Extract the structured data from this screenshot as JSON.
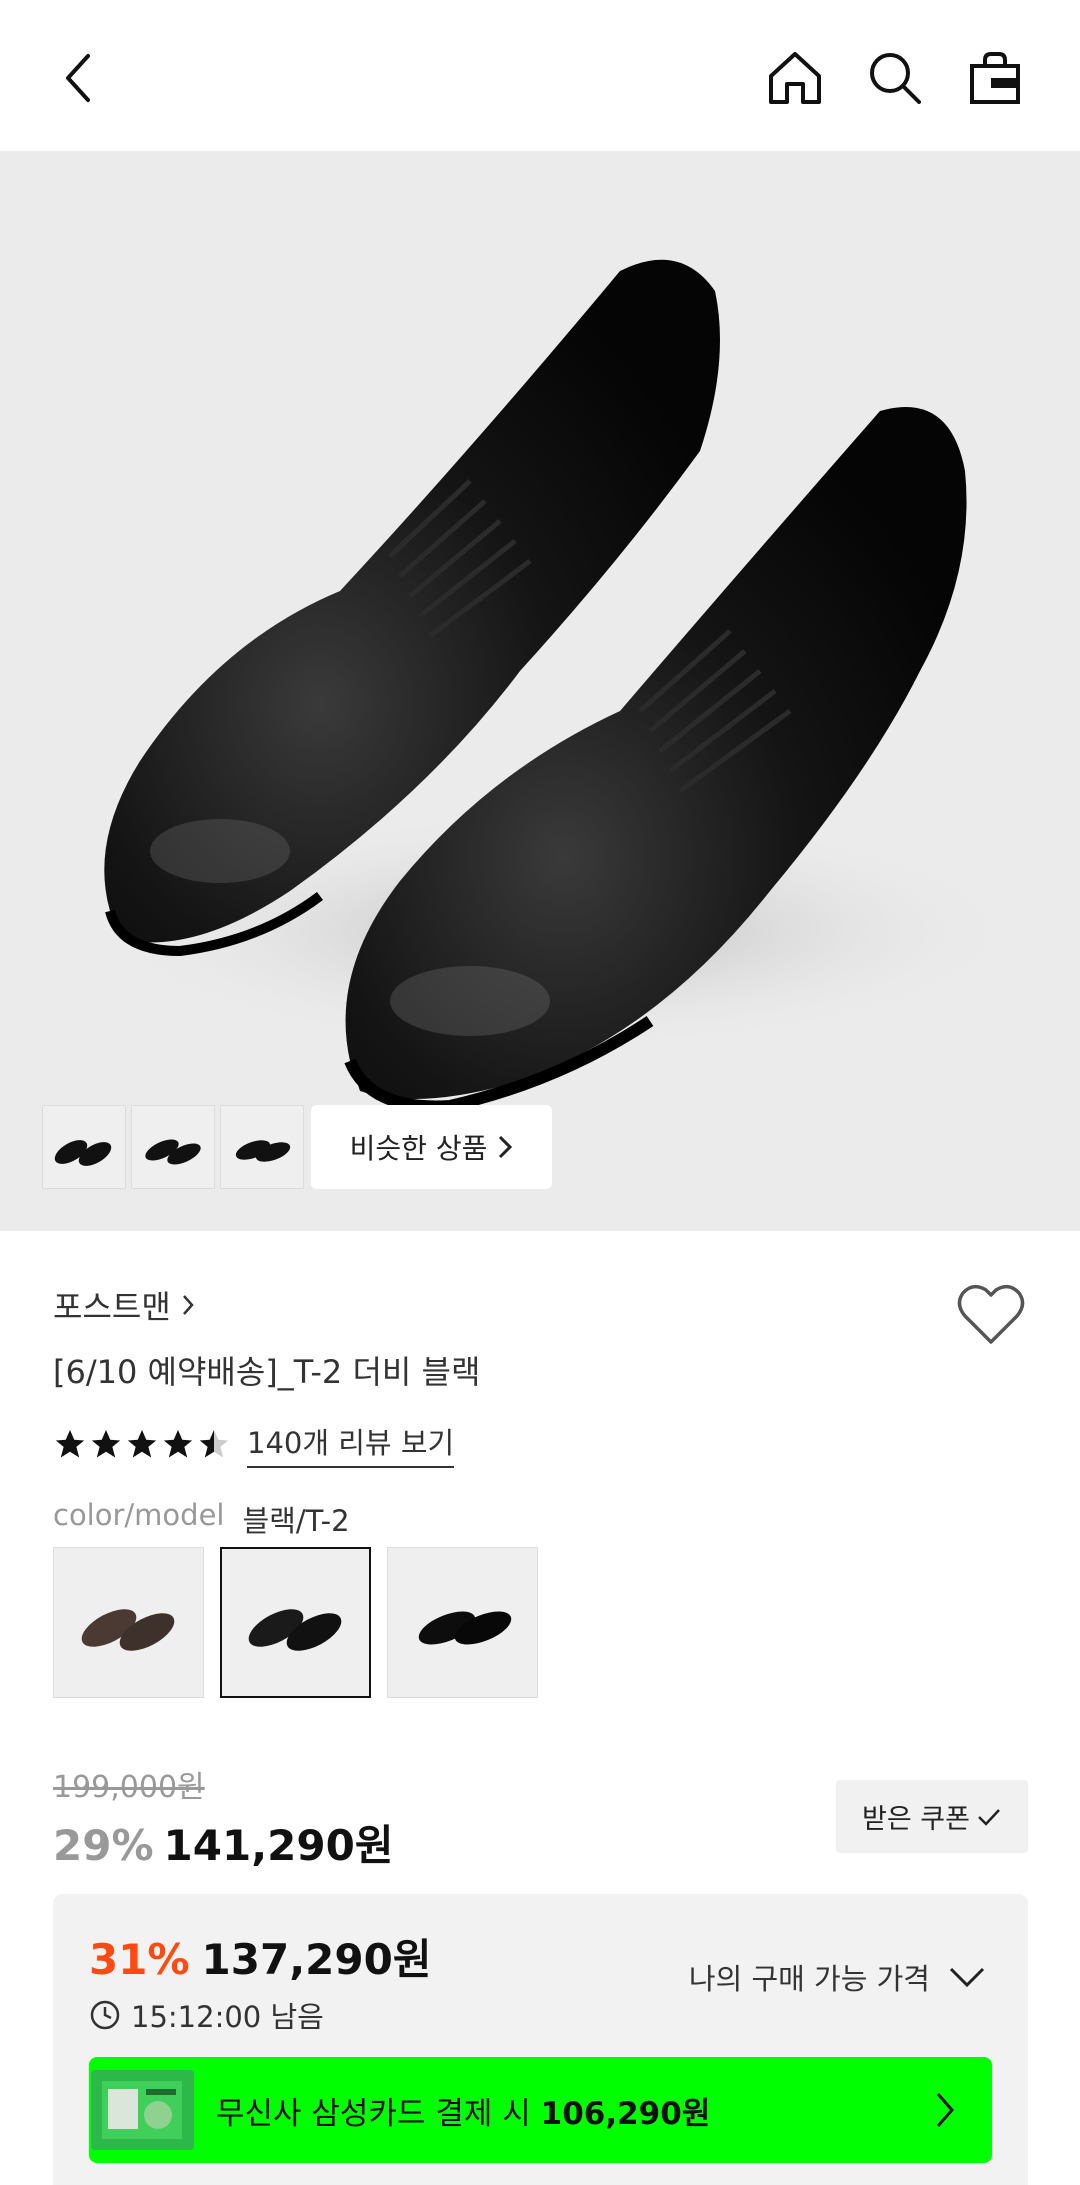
{
  "header": {
    "back_icon": "chevron-left-icon",
    "home_icon": "home-icon",
    "search_icon": "search-icon",
    "bag_icon": "shopping-bag-icon"
  },
  "gallery": {
    "similar_label": "비슷한 상품"
  },
  "product": {
    "brand": "포스트맨",
    "title": "[6/10 예약배송]_T-2 더비 블랙",
    "rating_stars": 4.5,
    "review_link": "140개 리뷰 보기",
    "color_label": "color/model",
    "color_value": "블랙/T-2",
    "swatch_colors": [
      "#4a3a33",
      "#1a1a1a",
      "#0d0d0d"
    ],
    "selected_swatch": 1
  },
  "price": {
    "original": "199,000원",
    "discount_pct": "29%",
    "sale": "141,290원",
    "coupon_label": "받은 쿠폰"
  },
  "benefit": {
    "best_pct": "31%",
    "best_price": "137,290원",
    "timer": "15:12:00 남음",
    "my_price_label": "나의 구매 가능 가격",
    "card_text_prefix": "무신사 삼성카드 결제 시",
    "card_price": "106,290원"
  },
  "colors": {
    "accent_orange": "#ff4a12",
    "banner_green": "#00ff00",
    "hero_bg": "#ebebeb"
  }
}
